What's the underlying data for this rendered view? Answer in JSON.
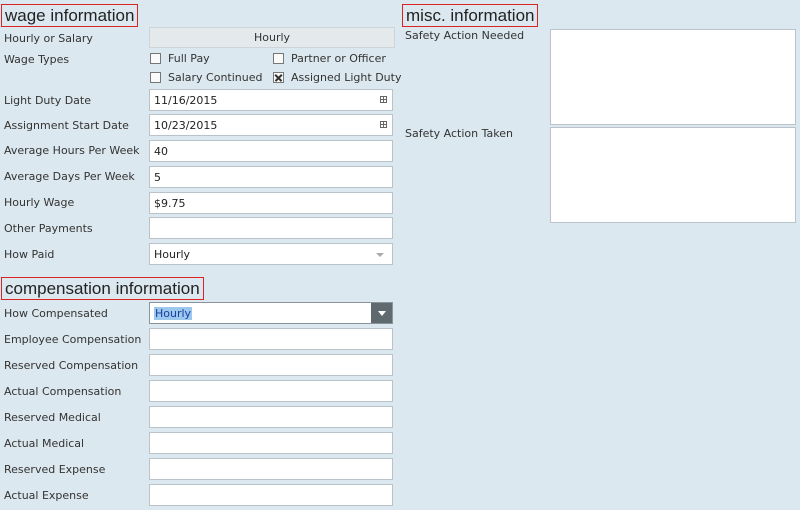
{
  "wage": {
    "title": "wage information",
    "hourly_or_salary_label": "Hourly or Salary",
    "hourly_or_salary_value": "Hourly",
    "wage_types_label": "Wage Types",
    "checkboxes": {
      "full_pay": {
        "label": "Full Pay",
        "checked": false
      },
      "partner_or_officer": {
        "label": "Partner or Officer",
        "checked": false
      },
      "salary_continued": {
        "label": "Salary Continued",
        "checked": false
      },
      "assigned_light_duty": {
        "label": "Assigned Light Duty",
        "checked": true
      }
    },
    "light_duty_date_label": "Light Duty Date",
    "light_duty_date_value": "11/16/2015",
    "assignment_start_date_label": "Assignment Start Date",
    "assignment_start_date_value": "10/23/2015",
    "avg_hours_label": "Average Hours Per Week",
    "avg_hours_value": "40",
    "avg_days_label": "Average Days Per Week",
    "avg_days_value": "5",
    "hourly_wage_label": "Hourly Wage",
    "hourly_wage_value": "$9.75",
    "other_payments_label": "Other Payments",
    "other_payments_value": "",
    "how_paid_label": "How Paid",
    "how_paid_value": "Hourly"
  },
  "compensation": {
    "title": "compensation information",
    "how_compensated_label": "How Compensated",
    "how_compensated_value": "Hourly",
    "employee_comp_label": "Employee Compensation",
    "reserved_comp_label": "Reserved Compensation",
    "actual_comp_label": "Actual Compensation",
    "reserved_medical_label": "Reserved Medical",
    "actual_medical_label": "Actual Medical",
    "reserved_expense_label": "Reserved Expense",
    "actual_expense_label": "Actual Expense"
  },
  "misc": {
    "title": "misc. information",
    "safety_needed_label": "Safety Action Needed",
    "safety_taken_label": "Safety Action Taken"
  },
  "icons": {
    "calendar": "calendar-icon",
    "dropdown": "chevron-down-icon"
  }
}
